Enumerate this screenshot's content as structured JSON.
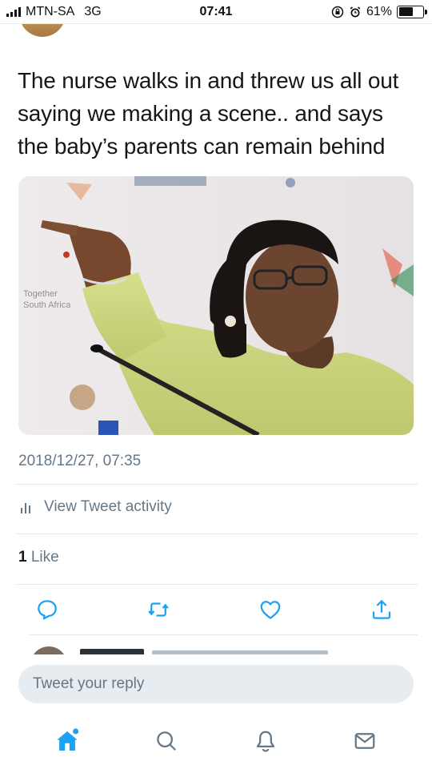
{
  "status_bar": {
    "carrier": "MTN-SA",
    "network": "3G",
    "time": "07:41",
    "battery_percent": "61%",
    "battery_level": 0.61
  },
  "tweet": {
    "text": "The nurse walks in and threw us all out saying we making a scene.. and says the baby’s parents can remain behind",
    "timestamp": "2018/12/27, 07:35",
    "activity_label": "View Tweet activity",
    "likes_count": "1",
    "likes_label": "Like"
  },
  "actions": [
    {
      "name": "reply-icon"
    },
    {
      "name": "retweet-icon"
    },
    {
      "name": "like-icon"
    },
    {
      "name": "share-icon"
    }
  ],
  "reply_box": {
    "placeholder": "Tweet your reply"
  },
  "tab_bar": [
    {
      "name": "home-icon",
      "active": true
    },
    {
      "name": "search-icon",
      "active": false
    },
    {
      "name": "notifications-icon",
      "active": false
    },
    {
      "name": "messages-icon",
      "active": false
    }
  ],
  "colors": {
    "accent": "#1da1f2",
    "secondary_text": "#657786",
    "divider": "#e1e8ed",
    "reply_box_bg": "#e6ecf0"
  }
}
